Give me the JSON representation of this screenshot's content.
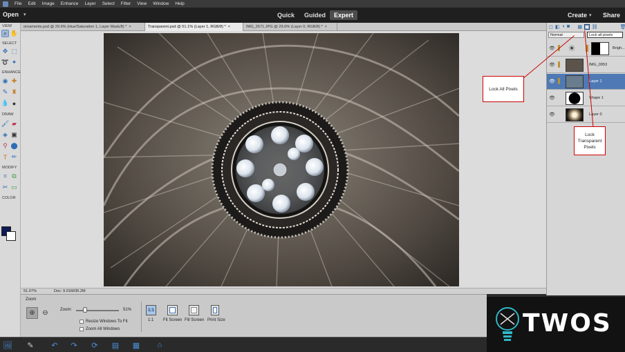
{
  "menubar": {
    "items": [
      "File",
      "Edit",
      "Image",
      "Enhance",
      "Layer",
      "Select",
      "Filter",
      "View",
      "Window",
      "Help"
    ]
  },
  "modebar": {
    "open_label": "Open",
    "modes": [
      "Quick",
      "Guided",
      "Expert"
    ],
    "active_mode": "Expert",
    "create_label": "Create",
    "share_label": "Share"
  },
  "toolbar": {
    "sections": [
      "VIEW",
      "SELECT",
      "ENHANCE",
      "DRAW",
      "MODIFY",
      "COLOR"
    ],
    "foreground_color": "#0d1a55",
    "background_color": "#ffffff"
  },
  "doctabs": [
    {
      "label": "ornaments.psd @ 29.6% (Hue/Saturation 1, Layer Mask/8) *",
      "active": false
    },
    {
      "label": "Transparent.psd @ 51.1% (Layer 1, RGB/8) *",
      "active": true
    },
    {
      "label": "IMG_2671.JPG @ 29.6% (Layer 0, RGB/8) *",
      "active": false
    }
  ],
  "statusbar": {
    "zoom": "51.07%",
    "doc": "Doc: 9.01M/36.2M"
  },
  "options": {
    "tool_name": "Zoom",
    "zoom_label": "Zoom:",
    "zoom_value": "51%",
    "zoom_fraction": 0.51,
    "resize_windows": "Resize Windows To Fit",
    "zoom_all": "Zoom All Windows",
    "one_to_one_icon": "1:1",
    "one_to_one": "1:1",
    "fit_screen": "Fit Screen",
    "fill_screen": "Fill Screen",
    "print_size": "Print Size"
  },
  "layers_panel": {
    "blend_mode": "Normal",
    "lock_mode": "Lock all pixels",
    "layers": [
      {
        "name": "Brigh...",
        "selected": false
      },
      {
        "name": "IMG_0953",
        "selected": false
      },
      {
        "name": "Layer 1",
        "selected": true
      },
      {
        "name": "Shape 1",
        "selected": false
      },
      {
        "name": "Layer 0",
        "selected": false
      }
    ]
  },
  "callouts": {
    "lock_all": "Lock All Pixels",
    "lock_transparent": "Lock Transparent Pixels"
  },
  "watermark": {
    "brand": "TWOS"
  },
  "colors": {
    "selection_blue": "#4e79b4",
    "accent_red": "#cc0000",
    "icon_blue": "#2f66a5"
  }
}
